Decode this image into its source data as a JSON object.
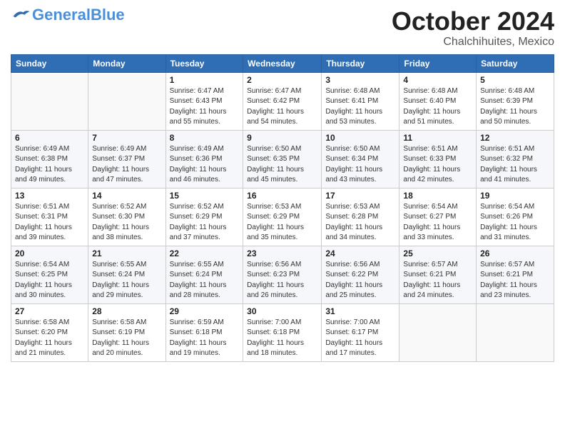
{
  "header": {
    "logo_general": "General",
    "logo_blue": "Blue",
    "month_title": "October 2024",
    "location": "Chalchihuites, Mexico"
  },
  "calendar": {
    "days_of_week": [
      "Sunday",
      "Monday",
      "Tuesday",
      "Wednesday",
      "Thursday",
      "Friday",
      "Saturday"
    ],
    "weeks": [
      [
        {
          "day": "",
          "info": ""
        },
        {
          "day": "",
          "info": ""
        },
        {
          "day": "1",
          "info": "Sunrise: 6:47 AM\nSunset: 6:43 PM\nDaylight: 11 hours\nand 55 minutes."
        },
        {
          "day": "2",
          "info": "Sunrise: 6:47 AM\nSunset: 6:42 PM\nDaylight: 11 hours\nand 54 minutes."
        },
        {
          "day": "3",
          "info": "Sunrise: 6:48 AM\nSunset: 6:41 PM\nDaylight: 11 hours\nand 53 minutes."
        },
        {
          "day": "4",
          "info": "Sunrise: 6:48 AM\nSunset: 6:40 PM\nDaylight: 11 hours\nand 51 minutes."
        },
        {
          "day": "5",
          "info": "Sunrise: 6:48 AM\nSunset: 6:39 PM\nDaylight: 11 hours\nand 50 minutes."
        }
      ],
      [
        {
          "day": "6",
          "info": "Sunrise: 6:49 AM\nSunset: 6:38 PM\nDaylight: 11 hours\nand 49 minutes."
        },
        {
          "day": "7",
          "info": "Sunrise: 6:49 AM\nSunset: 6:37 PM\nDaylight: 11 hours\nand 47 minutes."
        },
        {
          "day": "8",
          "info": "Sunrise: 6:49 AM\nSunset: 6:36 PM\nDaylight: 11 hours\nand 46 minutes."
        },
        {
          "day": "9",
          "info": "Sunrise: 6:50 AM\nSunset: 6:35 PM\nDaylight: 11 hours\nand 45 minutes."
        },
        {
          "day": "10",
          "info": "Sunrise: 6:50 AM\nSunset: 6:34 PM\nDaylight: 11 hours\nand 43 minutes."
        },
        {
          "day": "11",
          "info": "Sunrise: 6:51 AM\nSunset: 6:33 PM\nDaylight: 11 hours\nand 42 minutes."
        },
        {
          "day": "12",
          "info": "Sunrise: 6:51 AM\nSunset: 6:32 PM\nDaylight: 11 hours\nand 41 minutes."
        }
      ],
      [
        {
          "day": "13",
          "info": "Sunrise: 6:51 AM\nSunset: 6:31 PM\nDaylight: 11 hours\nand 39 minutes."
        },
        {
          "day": "14",
          "info": "Sunrise: 6:52 AM\nSunset: 6:30 PM\nDaylight: 11 hours\nand 38 minutes."
        },
        {
          "day": "15",
          "info": "Sunrise: 6:52 AM\nSunset: 6:29 PM\nDaylight: 11 hours\nand 37 minutes."
        },
        {
          "day": "16",
          "info": "Sunrise: 6:53 AM\nSunset: 6:29 PM\nDaylight: 11 hours\nand 35 minutes."
        },
        {
          "day": "17",
          "info": "Sunrise: 6:53 AM\nSunset: 6:28 PM\nDaylight: 11 hours\nand 34 minutes."
        },
        {
          "day": "18",
          "info": "Sunrise: 6:54 AM\nSunset: 6:27 PM\nDaylight: 11 hours\nand 33 minutes."
        },
        {
          "day": "19",
          "info": "Sunrise: 6:54 AM\nSunset: 6:26 PM\nDaylight: 11 hours\nand 31 minutes."
        }
      ],
      [
        {
          "day": "20",
          "info": "Sunrise: 6:54 AM\nSunset: 6:25 PM\nDaylight: 11 hours\nand 30 minutes."
        },
        {
          "day": "21",
          "info": "Sunrise: 6:55 AM\nSunset: 6:24 PM\nDaylight: 11 hours\nand 29 minutes."
        },
        {
          "day": "22",
          "info": "Sunrise: 6:55 AM\nSunset: 6:24 PM\nDaylight: 11 hours\nand 28 minutes."
        },
        {
          "day": "23",
          "info": "Sunrise: 6:56 AM\nSunset: 6:23 PM\nDaylight: 11 hours\nand 26 minutes."
        },
        {
          "day": "24",
          "info": "Sunrise: 6:56 AM\nSunset: 6:22 PM\nDaylight: 11 hours\nand 25 minutes."
        },
        {
          "day": "25",
          "info": "Sunrise: 6:57 AM\nSunset: 6:21 PM\nDaylight: 11 hours\nand 24 minutes."
        },
        {
          "day": "26",
          "info": "Sunrise: 6:57 AM\nSunset: 6:21 PM\nDaylight: 11 hours\nand 23 minutes."
        }
      ],
      [
        {
          "day": "27",
          "info": "Sunrise: 6:58 AM\nSunset: 6:20 PM\nDaylight: 11 hours\nand 21 minutes."
        },
        {
          "day": "28",
          "info": "Sunrise: 6:58 AM\nSunset: 6:19 PM\nDaylight: 11 hours\nand 20 minutes."
        },
        {
          "day": "29",
          "info": "Sunrise: 6:59 AM\nSunset: 6:18 PM\nDaylight: 11 hours\nand 19 minutes."
        },
        {
          "day": "30",
          "info": "Sunrise: 7:00 AM\nSunset: 6:18 PM\nDaylight: 11 hours\nand 18 minutes."
        },
        {
          "day": "31",
          "info": "Sunrise: 7:00 AM\nSunset: 6:17 PM\nDaylight: 11 hours\nand 17 minutes."
        },
        {
          "day": "",
          "info": ""
        },
        {
          "day": "",
          "info": ""
        }
      ]
    ]
  }
}
